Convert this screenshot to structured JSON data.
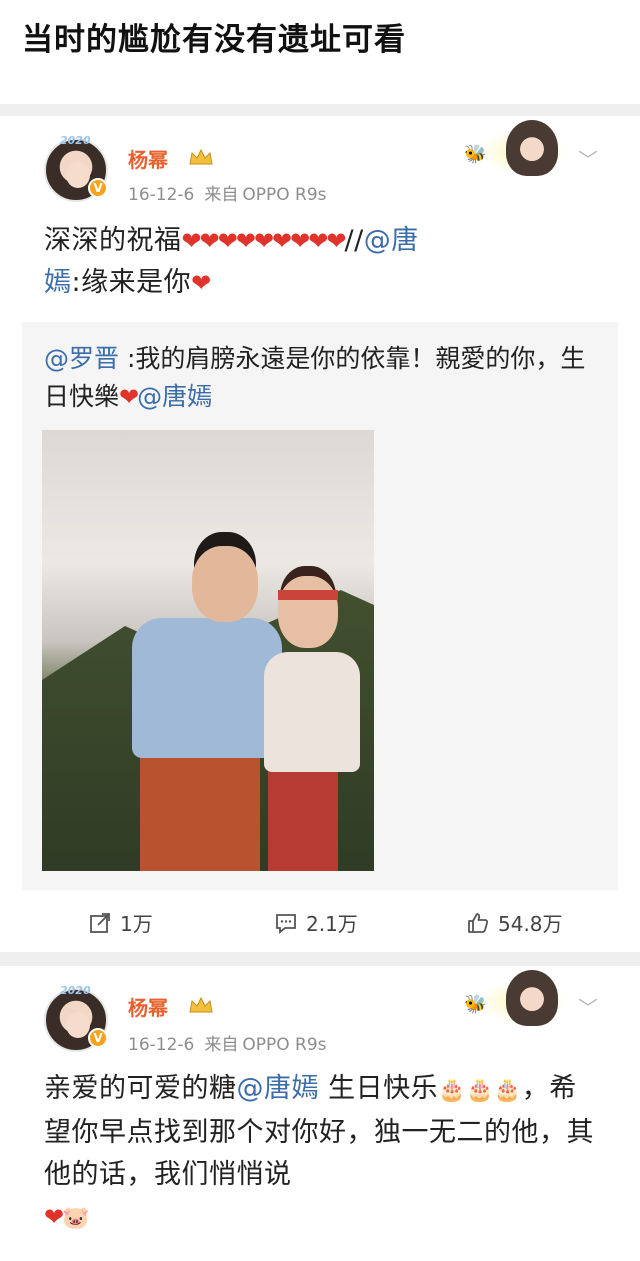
{
  "page_title": "当时的尴尬有没有遗址可看",
  "colors": {
    "username": "#e8612c",
    "mention": "#3b6dab",
    "heart": "#e0332c",
    "meta": "#8d8d8d",
    "repost_bg": "#f5f5f5"
  },
  "posts": [
    {
      "username": "杨幂",
      "date": "16-12-6",
      "source_label": "来自",
      "source_device": "OPPO R9s",
      "text": {
        "line1_text": "深深的祝福",
        "line1_hearts": "❤❤❤❤❤❤❤❤❤",
        "line1_slash": "//",
        "line1_mention": "@唐",
        "line2_mention": "嫣",
        "line2_text": ":缘来是你",
        "line2_heart": "❤"
      },
      "repost": {
        "mention": "@罗晋",
        "text_a": " :我的肩膀永遠是你的依靠！親愛的你，生日快樂",
        "heart": "❤",
        "mention2": "@唐嫣"
      },
      "actions": {
        "repost": "1万",
        "comment": "2.1万",
        "like": "54.8万"
      }
    },
    {
      "username": "杨幂",
      "date": "16-12-6",
      "source_label": "来自",
      "source_device": "OPPO R9s",
      "text": {
        "a": "亲爱的可爱的糖",
        "mention": "@唐嫣",
        "b": " 生日快乐",
        "cakes": "🎂🎂",
        "cake2": "🎂",
        "c": "，希望你早点找到那个对你好，独一无二的他，其他的话，我们悄悄说",
        "heart": "❤",
        "pig": "🐷"
      }
    }
  ]
}
